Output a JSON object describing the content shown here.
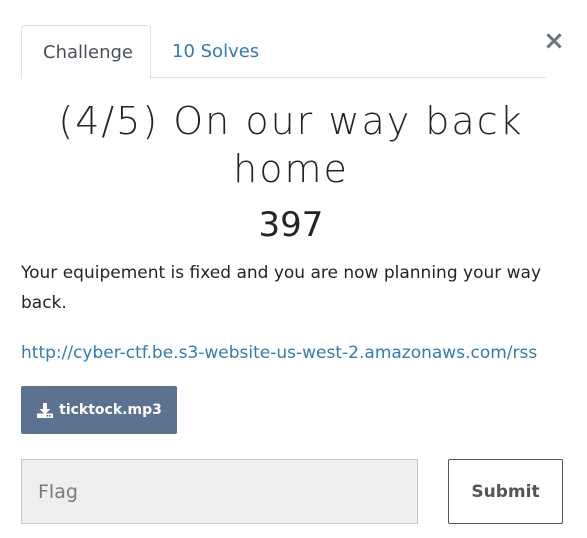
{
  "tabs": {
    "challenge_label": "Challenge",
    "solves_label": "10 Solves"
  },
  "close_symbol": "×",
  "challenge": {
    "title": "(4/5) On our way back home",
    "points": "397",
    "description": "Your equipement is fixed and you are now planning your way back.",
    "link": "http://cyber-ctf.be.s3-website-us-west-2.amazonaws.com/rss",
    "file": {
      "icon": "download-icon",
      "name": "ticktock.mp3"
    }
  },
  "form": {
    "flag_placeholder": "Flag",
    "flag_value": "",
    "submit_label": "Submit"
  },
  "colors": {
    "link": "#337ab7",
    "file_button": "#5b7290",
    "input_bg": "#eeeeee"
  }
}
